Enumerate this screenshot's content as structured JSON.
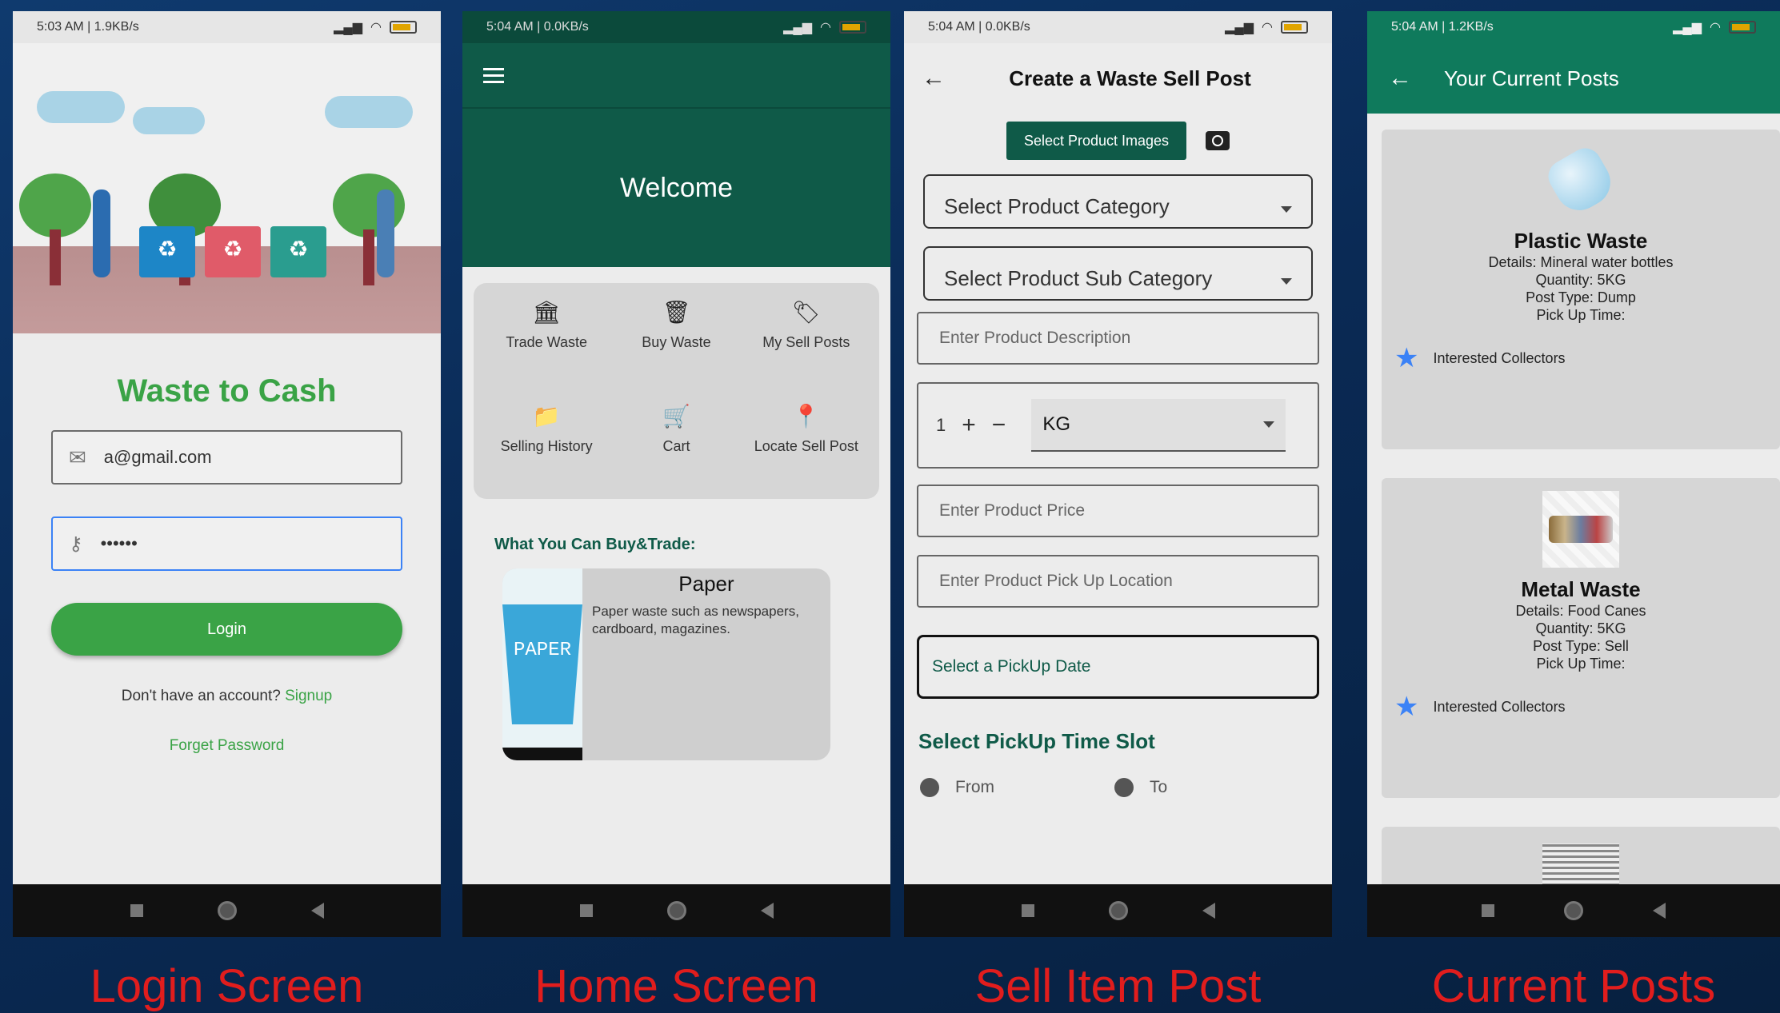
{
  "screens": {
    "login": {
      "status": {
        "time": "5:03 AM | 1.9KB/s",
        "battery": "81"
      },
      "app_title": "Waste to Cash",
      "email_value": "a@gmail.com",
      "password_value": "••••••",
      "login_label": "Login",
      "no_account": "Don't have an account? ",
      "signup_label": "Signup",
      "forget_label": "Forget Password",
      "caption": "Login Screen"
    },
    "home": {
      "status": {
        "time": "5:04 AM | 0.0KB/s",
        "battery": "85"
      },
      "welcome": "Welcome",
      "menu": [
        {
          "label": "Trade Waste",
          "icon": "bank-icon",
          "glyph": "🏛"
        },
        {
          "label": "Buy Waste",
          "icon": "trash-icon",
          "glyph": "🗑"
        },
        {
          "label": "My Sell Posts",
          "icon": "tag-icon",
          "glyph": "🏷"
        },
        {
          "label": "Selling History",
          "icon": "folder-icon",
          "glyph": "📁"
        },
        {
          "label": "Cart",
          "icon": "cart-icon",
          "glyph": "🛒"
        },
        {
          "label": "Locate Sell Post",
          "icon": "location-pin-icon",
          "glyph": "📍"
        }
      ],
      "section_label": "What You Can Buy&Trade:",
      "product": {
        "title": "Paper",
        "image_text": "PAPER",
        "description": "Paper waste such as newspapers, cardboard, magazines."
      },
      "caption": "Home Screen"
    },
    "sell": {
      "status": {
        "time": "5:04 AM | 0.0KB/s",
        "battery": "81"
      },
      "title": "Create a Waste Sell Post",
      "select_images": "Select Product Images",
      "category_placeholder": "Select Product Category",
      "subcategory_placeholder": "Select Product Sub Category",
      "description_placeholder": "Enter Product Description",
      "quantity": "1",
      "unit": "KG",
      "price_placeholder": "Enter Product Price",
      "location_placeholder": "Enter Product Pick Up Location",
      "date_label": "Select a PickUp Date",
      "time_slot_title": "Select PickUp Time Slot",
      "from_label": "From",
      "to_label": "To",
      "caption": "Sell Item Post"
    },
    "posts": {
      "status": {
        "time": "5:04 AM | 1.2KB/s",
        "battery": "81"
      },
      "title": "Your Current Posts",
      "items": [
        {
          "title": "Plastic Waste",
          "details": "Details: Mineral water bottles",
          "quantity": "Quantity: 5KG",
          "post_type": "Post Type: Dump",
          "pickup": "Pick Up Time:",
          "interested": "Interested Collectors"
        },
        {
          "title": "Metal Waste",
          "details": "Details: Food Canes",
          "quantity": "Quantity: 5KG",
          "post_type": "Post Type: Sell",
          "pickup": "Pick Up Time:",
          "interested": "Interested Collectors"
        }
      ],
      "caption": "Current Posts"
    }
  },
  "colors": {
    "brand_green": "#3aa346",
    "dark_green": "#0f5a48",
    "header_green": "#0f7a5c",
    "caption_red": "#e11d1d",
    "background_blue": "#0a2a55"
  }
}
